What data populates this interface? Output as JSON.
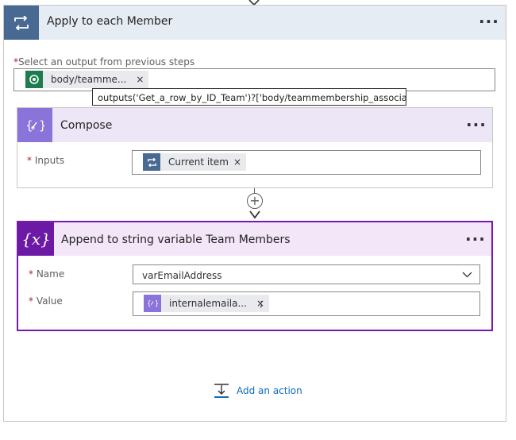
{
  "loop": {
    "title": "Apply to each Member",
    "more": "···",
    "select_label": "Select an output from previous steps",
    "required_mark": "*",
    "token": {
      "label": "body/teamme...",
      "remove": "×",
      "icon": "dataverse-icon"
    },
    "tooltip": "outputs('Get_a_row_by_ID_Team')?['body/teammembership_association']"
  },
  "compose": {
    "title": "Compose",
    "more": "···",
    "inputs_label": "Inputs",
    "required_mark": "*",
    "token": {
      "label": "Current item",
      "remove": "×",
      "icon": "loop-icon"
    }
  },
  "append": {
    "title": "Append to string variable Team Members",
    "icon_text": "{x}",
    "more": "···",
    "name_label": "Name",
    "name_value": "varEmailAddress",
    "value_label": "Value",
    "required_mark": "*",
    "value_token": {
      "label": "internalemaila...",
      "remove": "×",
      "icon": "compose-icon"
    },
    "value_suffix": ";"
  },
  "add_action": {
    "label": "Add an action"
  },
  "colors": {
    "loop": "#486991",
    "compose": "#8a74d9",
    "variable": "#6c1aa6",
    "accent": "#0f6cbd"
  }
}
